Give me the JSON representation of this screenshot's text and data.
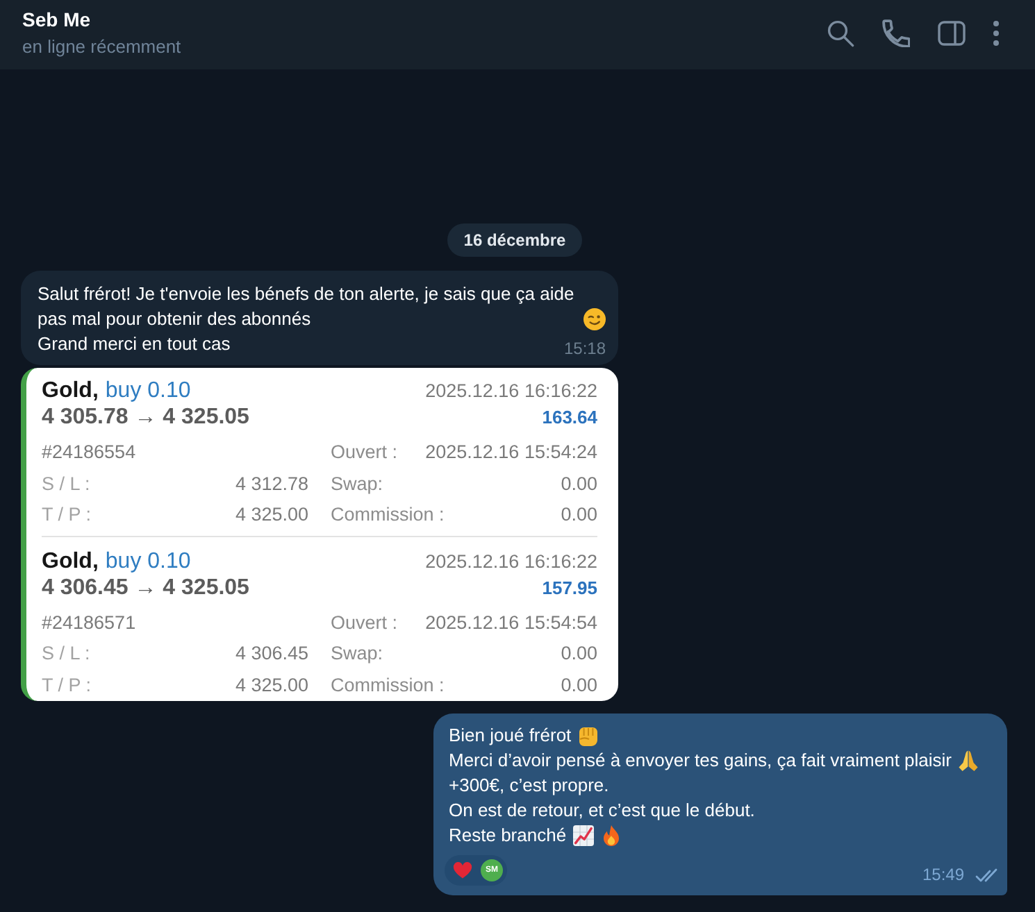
{
  "header": {
    "title": "Seb Me",
    "status": "en ligne récemment"
  },
  "date_badge": "16 décembre",
  "messages": [
    {
      "kind": "incoming_text",
      "paragraphs": [
        {
          "text": "Salut frérot! Je t'envoie les bénefs de ton alerte, je sais que ça aide pas mal pour obtenir des abonnés",
          "icons": [
            {
              "kind": "wink"
            }
          ]
        },
        {
          "text": "Grand merci en tout cas"
        }
      ],
      "time": "15:18"
    },
    {
      "kind": "trade_screenshot",
      "trades": [
        {
          "symbol": "Gold,",
          "order": "buy 0.10",
          "prices": "4 305.78 → 4 325.05",
          "close_time": "2025.12.16 16:16:22",
          "profit": "163.64",
          "ticket": "#24186554",
          "left_fields": [
            {
              "label": "S / L :",
              "value": "4 312.78"
            },
            {
              "label": "T / P :",
              "value": "4 325.00"
            }
          ],
          "right_fields": [
            {
              "label": "Ouvert :",
              "value": "2025.12.16 15:54:24"
            },
            {
              "label": "Swap:",
              "value": "0.00"
            },
            {
              "label": "Commission :",
              "value": "0.00"
            }
          ]
        },
        {
          "symbol": "Gold,",
          "order": "buy 0.10",
          "prices": "4 306.45 → 4 325.05",
          "close_time": "2025.12.16 16:16:22",
          "profit": "157.95",
          "ticket": "#24186571",
          "left_fields": [
            {
              "label": "S / L :",
              "value": "4 306.45"
            },
            {
              "label": "T / P :",
              "value": "4 325.00"
            }
          ],
          "right_fields": [
            {
              "label": "Ouvert :",
              "value": "2025.12.16 15:54:54"
            },
            {
              "label": "Swap:",
              "value": "0.00"
            },
            {
              "label": "Commission :",
              "value": "0.00"
            }
          ]
        }
      ]
    },
    {
      "kind": "outgoing_text",
      "paragraphs": [
        {
          "text": "Bien joué frérot",
          "icons": [
            {
              "kind": "fist"
            }
          ]
        },
        {
          "text": "Merci d’avoir pensé à envoyer tes gains, ça fait vraiment plaisir",
          "icons": [
            {
              "kind": "pray"
            }
          ]
        },
        {
          "text": "+300€, c’est propre."
        },
        {
          "text": "On est de retour, et c’est que le début."
        },
        {
          "text": "Reste branché",
          "icons": [
            {
              "kind": "chart_up"
            },
            {
              "kind": "fire"
            }
          ]
        }
      ],
      "reactions": [
        {
          "kind": "heart",
          "avatar_initials": "SM"
        }
      ],
      "time": "15:49",
      "read": true
    }
  ]
}
